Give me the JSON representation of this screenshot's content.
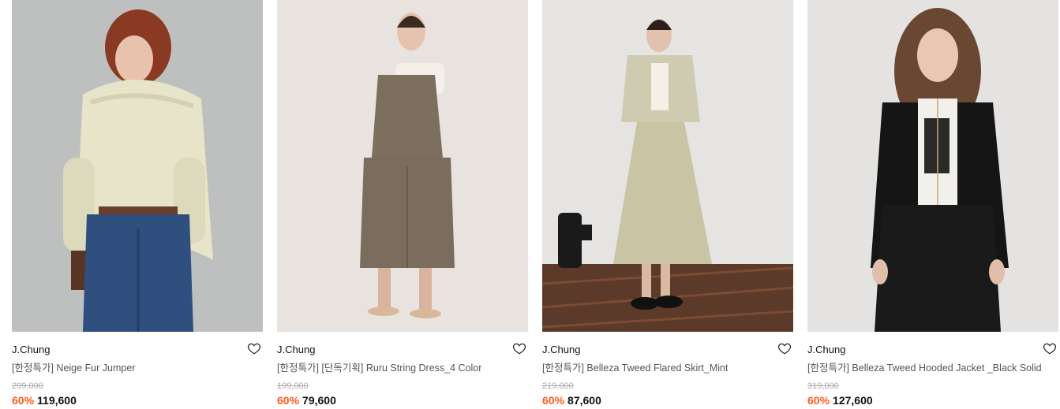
{
  "products": [
    {
      "brand": "J.Chung",
      "title": "[한정특가] Neige Fur Jumper",
      "original_price": "299,000",
      "discount": "60%",
      "sale_price": "119,600",
      "wishlist_icon": "heart-outline-icon",
      "image_desc": "model in cream fur hooded jumper and blue jeans"
    },
    {
      "brand": "J.Chung",
      "title": "[한정특가] [단독기획] Ruru String Dress_4 Color",
      "original_price": "199,000",
      "discount": "60%",
      "sale_price": "79,600",
      "wishlist_icon": "heart-outline-icon",
      "image_desc": "model in khaki string dress over white tee"
    },
    {
      "brand": "J.Chung",
      "title": "[한정특가] Belleza Tweed Flared Skirt_Mint",
      "original_price": "219,000",
      "discount": "60%",
      "sale_price": "87,600",
      "wishlist_icon": "heart-outline-icon",
      "image_desc": "model in mint tweed jacket and flared skirt"
    },
    {
      "brand": "J.Chung",
      "title": "[한정특가] Belleza Tweed Hooded Jacket _Black Solid",
      "original_price": "319,000",
      "discount": "60%",
      "sale_price": "127,600",
      "wishlist_icon": "heart-outline-icon",
      "image_desc": "model in black tweed jacket and skirt"
    }
  ],
  "colors": {
    "discount": "#ff5a1f",
    "text": "#111111",
    "muted": "#555555",
    "strike": "#aaaaaa"
  }
}
